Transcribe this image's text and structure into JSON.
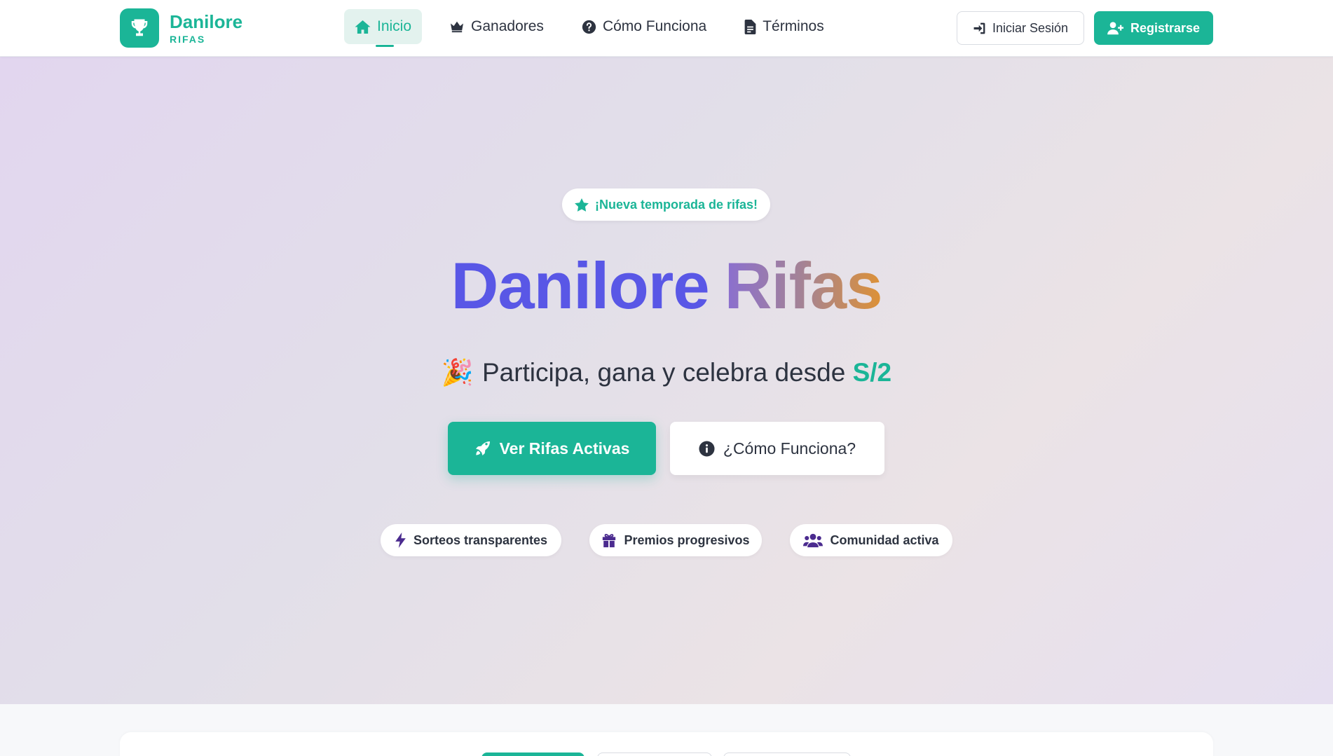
{
  "brand": {
    "name": "Danilore",
    "subtitle": "RIFAS"
  },
  "nav": {
    "items": [
      {
        "label": "Inicio",
        "icon": "home-icon",
        "active": true
      },
      {
        "label": "Ganadores",
        "icon": "crown-icon",
        "active": false
      },
      {
        "label": "Cómo Funciona",
        "icon": "question-circle-icon",
        "active": false
      },
      {
        "label": "Términos",
        "icon": "document-icon",
        "active": false
      }
    ],
    "login_label": "Iniciar Sesión",
    "register_label": "Registrarse"
  },
  "hero": {
    "badge": "¡Nueva temporada de rifas!",
    "title_word1": "Danilore",
    "title_word2": "Rifas",
    "subtitle_emoji": "🎉",
    "subtitle_text": "Participa, gana y celebra desde",
    "subtitle_price": "S/2",
    "primary_cta": "Ver Rifas Activas",
    "secondary_cta": "¿Cómo Funciona?",
    "features": [
      {
        "label": "Sorteos transparentes",
        "icon": "bolt-icon"
      },
      {
        "label": "Premios progresivos",
        "icon": "gift-icon"
      },
      {
        "label": "Comunidad activa",
        "icon": "users-icon"
      }
    ]
  },
  "colors": {
    "accent": "#1bb597",
    "title_primary": "#5957e6",
    "title_gradient_start": "#8a6fd0",
    "title_gradient_end": "#dd9136",
    "feature_icon": "#4b2b8f",
    "text": "#2d3340"
  }
}
